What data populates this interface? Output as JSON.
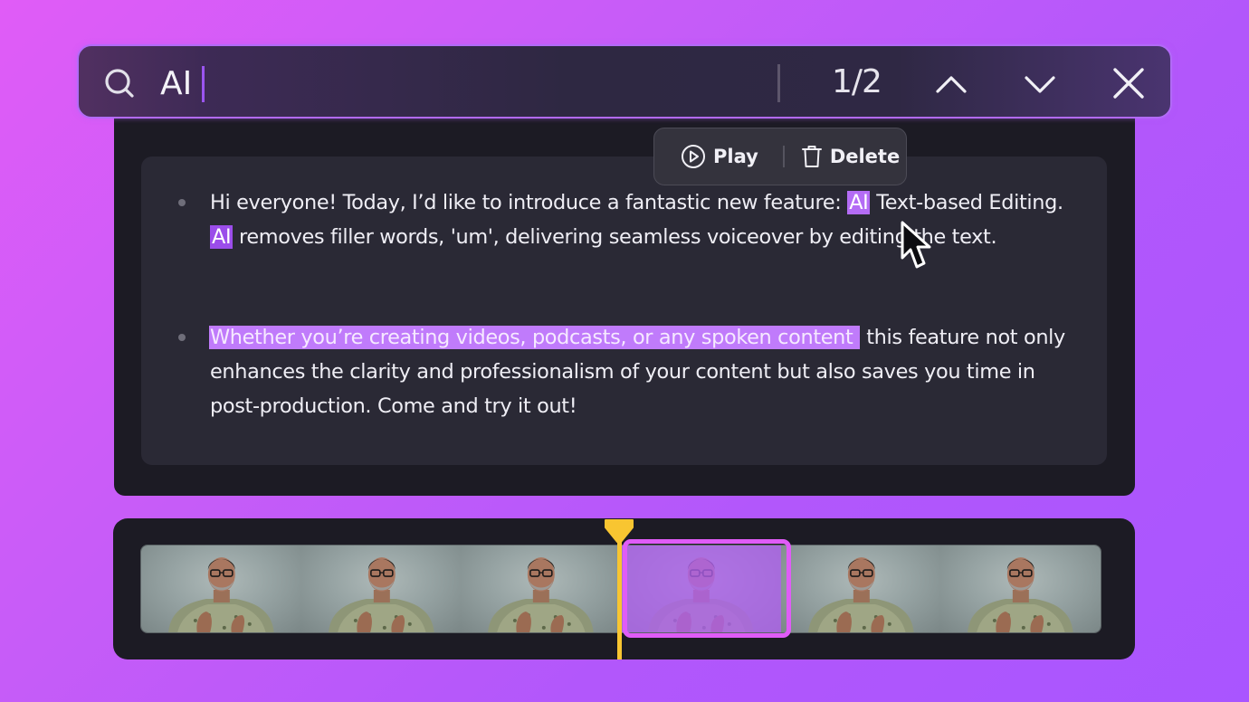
{
  "search": {
    "query": "AI",
    "placeholder": "",
    "match_counter": "1/2",
    "icons": {
      "search": "search-icon",
      "previous": "chevron-up-icon",
      "next": "chevron-down-icon",
      "close": "close-icon"
    }
  },
  "context_menu": {
    "items": [
      {
        "label": "Play",
        "icon": "play-circle-icon"
      },
      {
        "label": "Delete",
        "icon": "trash-icon"
      }
    ]
  },
  "transcript": {
    "paragraphs": [
      {
        "segments": [
          {
            "text": "Hi everyone! Today, I’d like to introduce a fantastic new feature: ",
            "style": "plain"
          },
          {
            "text": "AI",
            "style": "match-current"
          },
          {
            "text": " Text-based Editing. ",
            "style": "plain"
          },
          {
            "text": "AI",
            "style": "match"
          },
          {
            "text": " removes filler words, 'um', delivering seamless voiceover by editing the text.",
            "style": "plain"
          }
        ]
      },
      {
        "segments": [
          {
            "text": "Whether you’re creating videos, podcasts, or any spoken content",
            "style": "selected"
          },
          {
            "text": " this feature not only enhances the clarity and professionalism of your content but also saves you time in post-production. Come and try it out!",
            "style": "plain"
          }
        ]
      }
    ]
  },
  "timeline": {
    "frame_count": 6,
    "selected_frame_index": 3,
    "playhead_color": "#f8c531",
    "selection_color": "#e05cf7"
  },
  "colors": {
    "match_highlight": "#9b4dea",
    "selection_highlight": "#c07bfb",
    "panel_bg": "#1c1b24",
    "card_bg": "#2a2935"
  }
}
